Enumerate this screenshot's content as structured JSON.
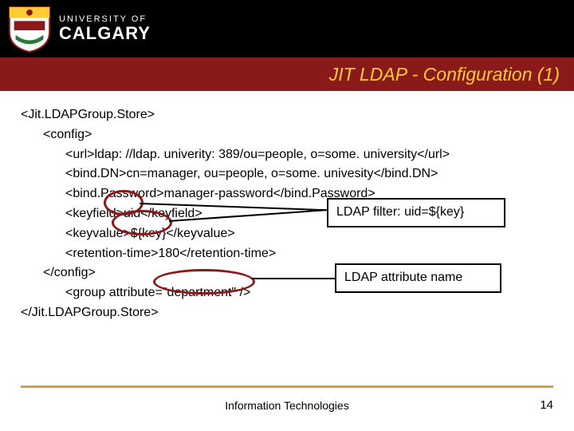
{
  "header": {
    "uni_top": "UNIVERSITY OF",
    "uni_bot": "CALGARY",
    "title": "JIT LDAP - Configuration (1)"
  },
  "code": {
    "l1": "<Jit.LDAPGroup.Store>",
    "l2": "<config>",
    "l3": "<url>ldap: //ldap. univerity: 389/ou=people, o=some. university</url>",
    "l4": "<bind.DN>cn=manager, ou=people, o=some. univesity</bind.DN>",
    "l5": "<bind.Password>manager-password</bind.Password>",
    "l6": "<keyfield>uid</keyfield>",
    "l7": "<keyvalue>${key}</keyvalue>",
    "l8": "<retention-time>180</retention-time>",
    "l9": "</config>",
    "l10": "<group attribute=\"department\" />",
    "l11": "</Jit.LDAPGroup.Store>"
  },
  "callouts": {
    "filter": "LDAP filter: uid=${key}",
    "attr": "LDAP attribute name"
  },
  "footer": {
    "org": "Information Technologies",
    "page": "14"
  }
}
